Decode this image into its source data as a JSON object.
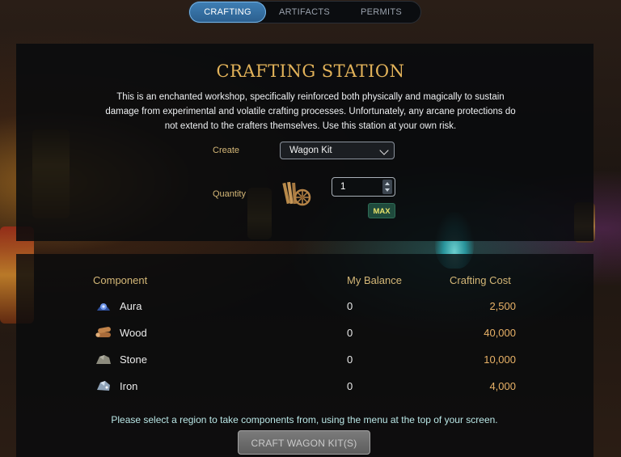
{
  "tabs": [
    {
      "label": "CRAFTING",
      "active": true
    },
    {
      "label": "ARTIFACTS",
      "active": false
    },
    {
      "label": "PERMITS",
      "active": false
    }
  ],
  "station": {
    "title": "CRAFTING STATION",
    "description": "This is an enchanted workshop, specifically reinforced both physically and magically to sustain damage from experimental and volatile crafting processes. Unfortunately, any arcane protections do not extend to the crafters themselves. Use this station at your own risk."
  },
  "form": {
    "create_label": "Create",
    "create_value": "Wagon Kit",
    "quantity_label": "Quantity",
    "quantity_value": "1",
    "max_label": "MAX"
  },
  "table": {
    "headers": {
      "component": "Component",
      "balance": "My Balance",
      "cost": "Crafting Cost"
    },
    "rows": [
      {
        "name": "Aura",
        "balance": "0",
        "cost": "2,500",
        "icon": "aura-icon"
      },
      {
        "name": "Wood",
        "balance": "0",
        "cost": "40,000",
        "icon": "wood-icon"
      },
      {
        "name": "Stone",
        "balance": "0",
        "cost": "10,000",
        "icon": "stone-icon"
      },
      {
        "name": "Iron",
        "balance": "0",
        "cost": "4,000",
        "icon": "iron-icon"
      }
    ]
  },
  "note": "Please select a region to take components from, using the menu at the top of your screen.",
  "craft_button": "CRAFT WAGON KIT(S)",
  "colors": {
    "accent": "#e3b35a",
    "label": "#d4b777",
    "cost": "#e9b267",
    "note": "#b9e6e6",
    "tab_active": "#3f7fb5"
  }
}
